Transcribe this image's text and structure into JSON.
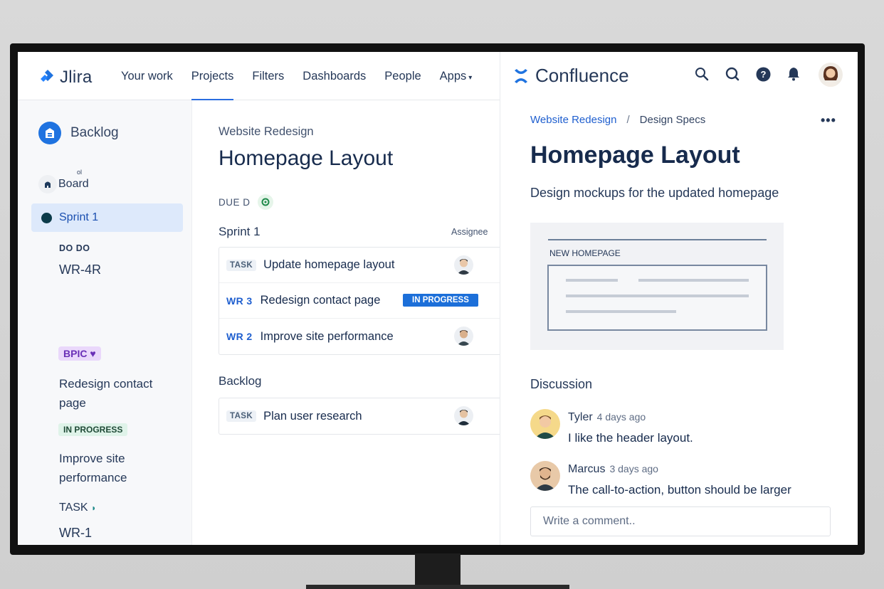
{
  "jira": {
    "logo_text": "Jlira",
    "nav": [
      "Your work",
      "Projects",
      "Filters",
      "Dashboards",
      "People",
      "Apps"
    ],
    "active_nav": "Projects",
    "sidebar": {
      "backlog": "Backlog",
      "board_small": "ol",
      "board": "Board",
      "sprint": "Sprint 1",
      "todo_label": "DO DO",
      "todo_key": "WR-4R",
      "epic_label": "BPIC",
      "epic_title": "Redesign contact page",
      "inprogress_label": "IN PROGRESS",
      "inprogress_title": "Improve site performance",
      "task_label": "TASK",
      "task_key": "WR-1"
    },
    "main": {
      "project": "Website Redesign",
      "title": "Homepage Layout",
      "due_label": "DUE D",
      "sprint_header": "Sprint 1",
      "assignee_header": "Assignee",
      "sprint_issues": [
        {
          "key": "TASK",
          "title": "Update homepage layout"
        },
        {
          "key": "WR 3",
          "title": "Redesign contact page",
          "status": "IN PROGRESS"
        },
        {
          "key": "WR 2",
          "title": "Improve site performance"
        }
      ],
      "backlog_header": "Backlog",
      "backlog_issues": [
        {
          "key": "TASK",
          "title": "Plan user research"
        }
      ]
    }
  },
  "confluence": {
    "logo_text": "Confluence",
    "icons": [
      "search-icon",
      "search-alt-icon",
      "help-icon",
      "notification-bell-icon",
      "user-avatar"
    ],
    "breadcrumb": {
      "space": "Website Redesign",
      "separator": "/",
      "page": "Design Specs"
    },
    "more": "•••",
    "title": "Homepage Layout",
    "subtitle": "Design mockups for the updated homepage",
    "mockup_label": "NEW HOMEPAGE",
    "discussion_header": "Discussion",
    "comments": [
      {
        "author": "Tyler",
        "time": "4 days ago",
        "text": "I like the header layout."
      },
      {
        "author": "Marcus",
        "time": "3 days ago",
        "text": "The call-to-action, button should be larger"
      }
    ],
    "comment_placeholder": "Write a comment.."
  },
  "colors": {
    "accent": "#1f73e0",
    "status_in_progress": "#1c6fd9",
    "epic": "#6a2fb7",
    "sprint_highlight": "#dde9fb"
  }
}
